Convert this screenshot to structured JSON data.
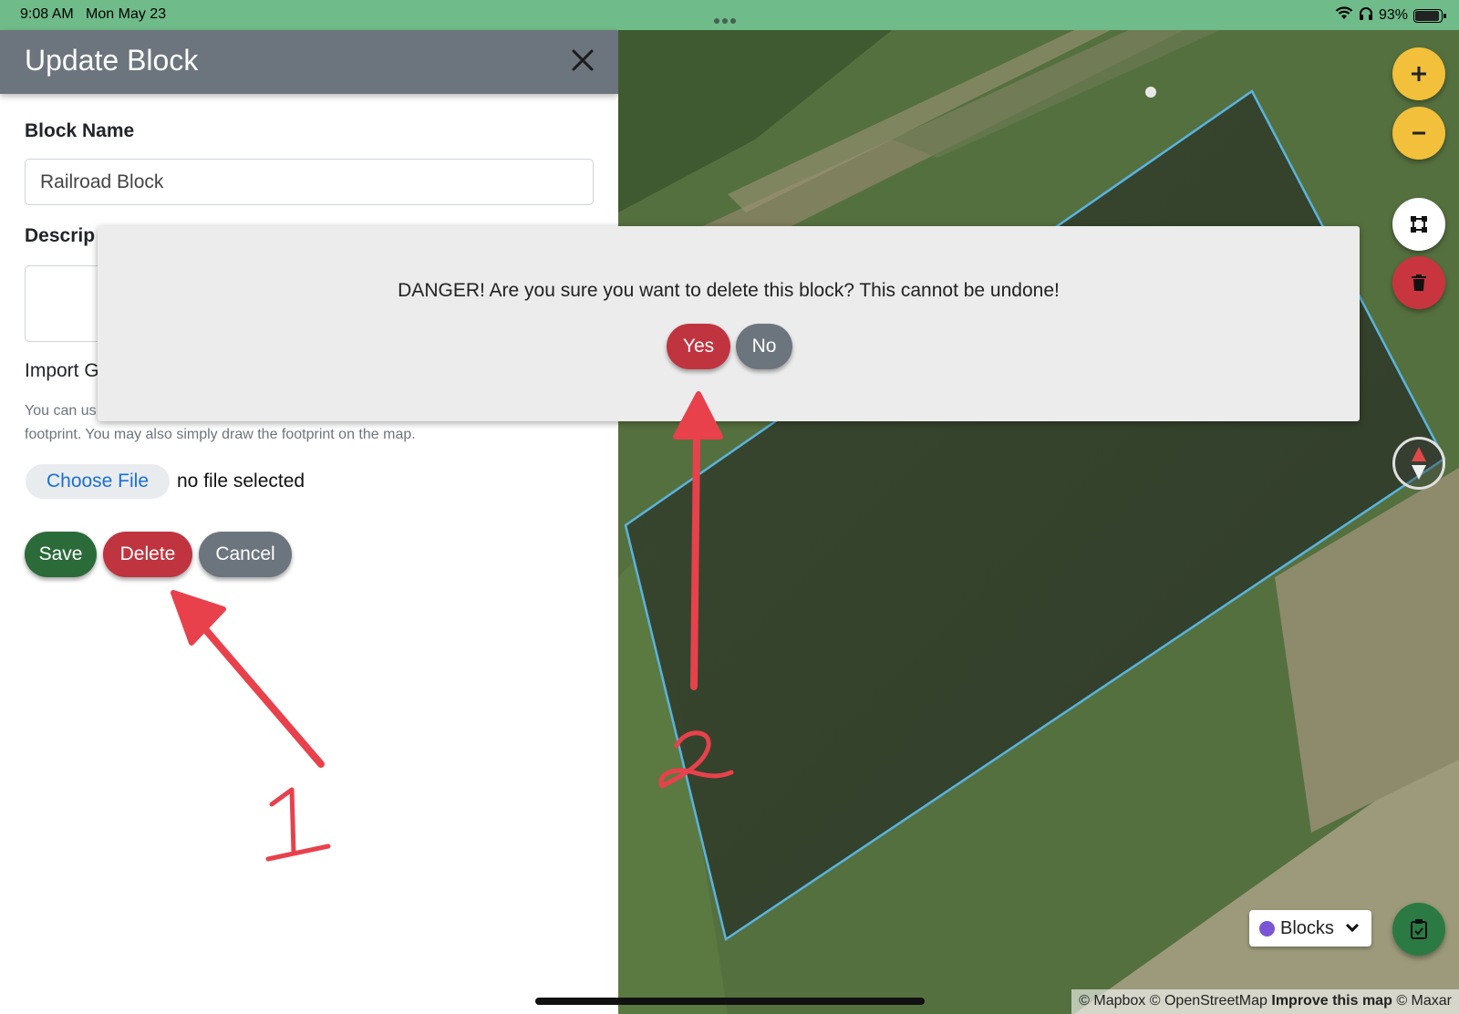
{
  "status_bar": {
    "time": "9:08 AM",
    "date": "Mon May 23",
    "battery": "93%",
    "icons": [
      "wifi-icon",
      "headphones-icon",
      "battery-icon"
    ]
  },
  "panel": {
    "title": "Update Block",
    "close_icon": "close-icon",
    "block_name_label": "Block Name",
    "block_name_value": "Railroad Block",
    "description_label": "Descrip",
    "import_label": "Import G",
    "help_text_line1": "You can us",
    "help_text_line2": "footprint. You may also simply draw the footprint on the map.",
    "choose_file_label": "Choose File",
    "no_file_text": "no file selected",
    "buttons": {
      "save": "Save",
      "delete": "Delete",
      "cancel": "Cancel"
    }
  },
  "dialog": {
    "message": "DANGER! Are you sure you want to delete this block? This cannot be undone!",
    "yes_label": "Yes",
    "no_label": "No"
  },
  "map": {
    "controls": {
      "zoom_in": "+",
      "zoom_out": "−",
      "icons": [
        "plus-icon",
        "minus-icon",
        "draw-polygon-icon",
        "trash-icon",
        "compass-icon",
        "clipboard-check-icon"
      ]
    },
    "layer_select": {
      "selected": "Blocks",
      "dot_color": "#7b55d6"
    },
    "attribution": {
      "mapbox": "© Mapbox",
      "osm": "© OpenStreetMap",
      "improve": "Improve this map",
      "maxar": "© Maxar"
    },
    "polygon_color": "#5ab4e0"
  },
  "annotations": {
    "label_1": "1",
    "label_2": "2",
    "color": "#e8414c"
  },
  "colors": {
    "status_bar": "#6fbb89",
    "header": "#6c757d",
    "save": "#2b6b3a",
    "delete": "#c0343f",
    "cancel": "#6c757d",
    "fab_yellow": "#f2c03a"
  }
}
